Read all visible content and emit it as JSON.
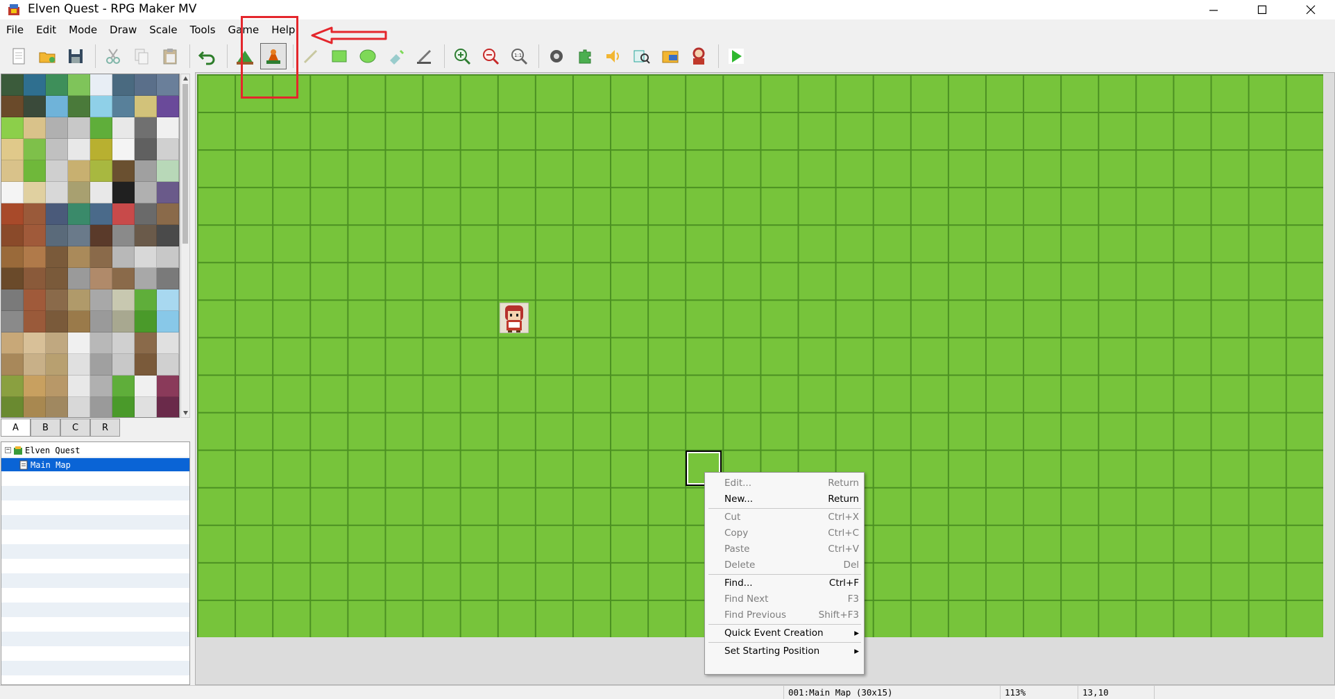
{
  "window": {
    "title": "Elven Quest - RPG Maker MV"
  },
  "menu": [
    "File",
    "Edit",
    "Mode",
    "Draw",
    "Scale",
    "Tools",
    "Game",
    "Help"
  ],
  "toolbar": {
    "buttons": [
      "new-project",
      "open-project",
      "save-project",
      "cut",
      "copy",
      "paste",
      "undo",
      "map-mode",
      "event-mode",
      "pencil",
      "rectangle",
      "ellipse",
      "flood-fill",
      "shadow-pen",
      "zoom-in",
      "zoom-out",
      "zoom-actual",
      "database",
      "plugin-manager",
      "sound-test",
      "event-searcher",
      "resource-manager",
      "character-generator",
      "playtest"
    ],
    "active": "event-mode"
  },
  "tileset_tabs": [
    {
      "label": "A",
      "selected": true
    },
    {
      "label": "B",
      "selected": false
    },
    {
      "label": "C",
      "selected": false
    },
    {
      "label": "R",
      "selected": false
    }
  ],
  "map_tree": [
    {
      "label": "Elven Quest",
      "type": "project",
      "expanded": true
    },
    {
      "label": "Main Map",
      "type": "map",
      "selected": true
    }
  ],
  "map": {
    "cols": 30,
    "rows": 15,
    "player_start": [
      8,
      6
    ],
    "selected_tile": [
      13,
      10
    ],
    "grass_color": "#77c43b",
    "grid_color": "#4b9022"
  },
  "context_menu": [
    {
      "label": "Edit...",
      "shortcut": "Return",
      "enabled": false
    },
    {
      "label": "New...",
      "shortcut": "Return",
      "enabled": true
    },
    {
      "separator": true
    },
    {
      "label": "Cut",
      "shortcut": "Ctrl+X",
      "enabled": false
    },
    {
      "label": "Copy",
      "shortcut": "Ctrl+C",
      "enabled": false
    },
    {
      "label": "Paste",
      "shortcut": "Ctrl+V",
      "enabled": false
    },
    {
      "label": "Delete",
      "shortcut": "Del",
      "enabled": false
    },
    {
      "separator": true
    },
    {
      "label": "Find...",
      "shortcut": "Ctrl+F",
      "enabled": true
    },
    {
      "label": "Find Next",
      "shortcut": "F3",
      "enabled": false
    },
    {
      "label": "Find Previous",
      "shortcut": "Shift+F3",
      "enabled": false
    },
    {
      "separator": true
    },
    {
      "label": "Quick Event Creation",
      "shortcut": "▸",
      "enabled": true
    },
    {
      "separator": true
    },
    {
      "label": "Set Starting Position",
      "shortcut": "▸",
      "enabled": true
    }
  ],
  "status": {
    "map": "001:Main Map (30x15)",
    "zoom": "113%",
    "coords": "13,10"
  },
  "annotation": {
    "color": "#e4262c"
  }
}
